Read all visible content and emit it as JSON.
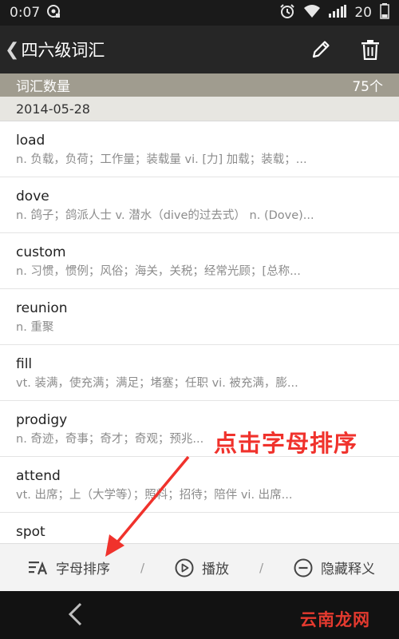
{
  "status_bar": {
    "time": "0:07",
    "battery_level": "20"
  },
  "app_bar": {
    "title": "四六级词汇"
  },
  "summary": {
    "label": "词汇数量",
    "count": "75个"
  },
  "date_header": "2014-05-28",
  "words": [
    {
      "word": "load",
      "meaning": "n. 负载，负荷；工作量；装载量 vi. [力] 加载；装载；..."
    },
    {
      "word": "dove",
      "meaning": "n. 鸽子；鸽派人士 v. 潜水（dive的过去式） n. (Dove)..."
    },
    {
      "word": "custom",
      "meaning": "n. 习惯，惯例；风俗；海关，关税；经常光顾；[总称..."
    },
    {
      "word": "reunion",
      "meaning": "n. 重聚"
    },
    {
      "word": "fill",
      "meaning": "vt. 装满，使充满；满足；堵塞；任职 vi. 被充满，膨..."
    },
    {
      "word": "prodigy",
      "meaning": "n. 奇迹，奇事；奇才；奇观；预兆..."
    },
    {
      "word": "attend",
      "meaning": "vt. 出席；上（大学等）；照料；招待；陪伴 vi. 出席..."
    },
    {
      "word": "spot",
      "meaning": ""
    }
  ],
  "bottom_bar": {
    "sort_label": "字母排序",
    "play_label": "播放",
    "hide_label": "隐藏释义",
    "separator": "/"
  },
  "annotation": {
    "text": "点击字母排序",
    "color": "#f0322c"
  },
  "watermark": "云南龙网",
  "colors": {
    "app_bar": "#262626",
    "summary_bar": "#a09c8f",
    "date_bar": "#e7e6e1",
    "annotation": "#f0322c"
  }
}
